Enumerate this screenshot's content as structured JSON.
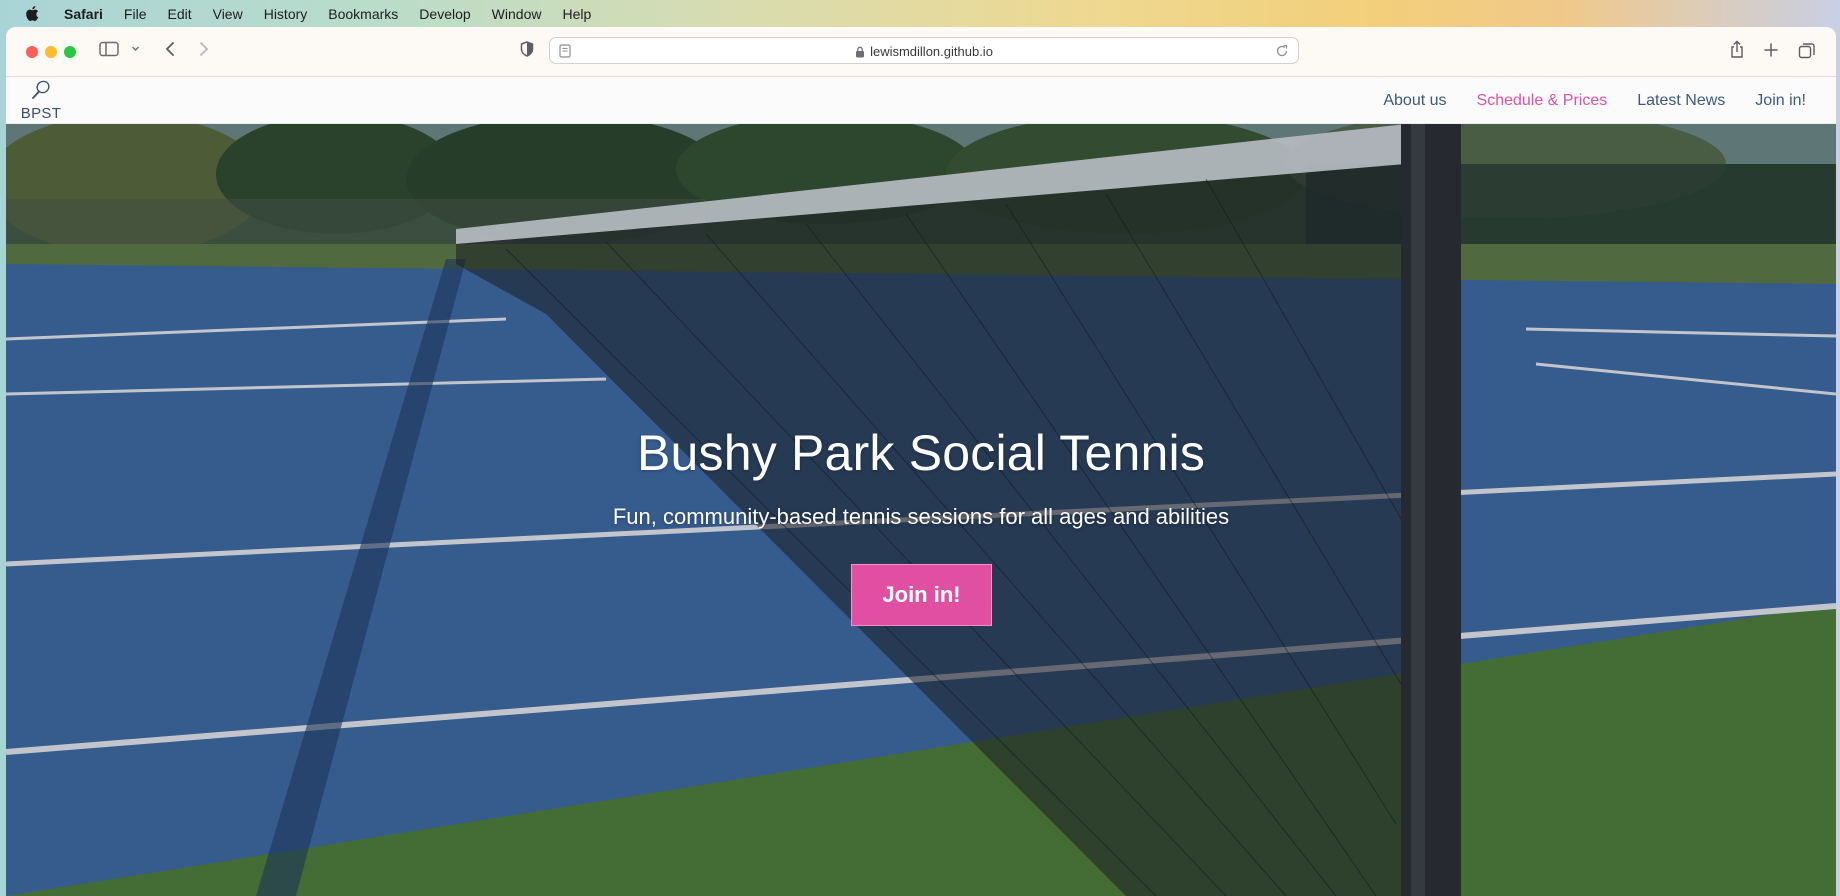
{
  "menubar": {
    "app_name": "Safari",
    "items": [
      "File",
      "Edit",
      "View",
      "History",
      "Bookmarks",
      "Develop",
      "Window",
      "Help"
    ]
  },
  "browser": {
    "url": "lewismdillon.github.io"
  },
  "site": {
    "logo_text": "BPST",
    "nav": [
      {
        "label": "About us",
        "active": false
      },
      {
        "label": "Schedule & Prices",
        "active": true
      },
      {
        "label": "Latest News",
        "active": false
      },
      {
        "label": "Join in!",
        "active": false
      }
    ],
    "hero": {
      "title": "Bushy Park Social Tennis",
      "subtitle": "Fun, community-based tennis sessions for all ages and abilities",
      "button_label": "Join in!"
    }
  },
  "colors": {
    "accent": "#e04fa1",
    "nav_text": "#3e5a78"
  }
}
